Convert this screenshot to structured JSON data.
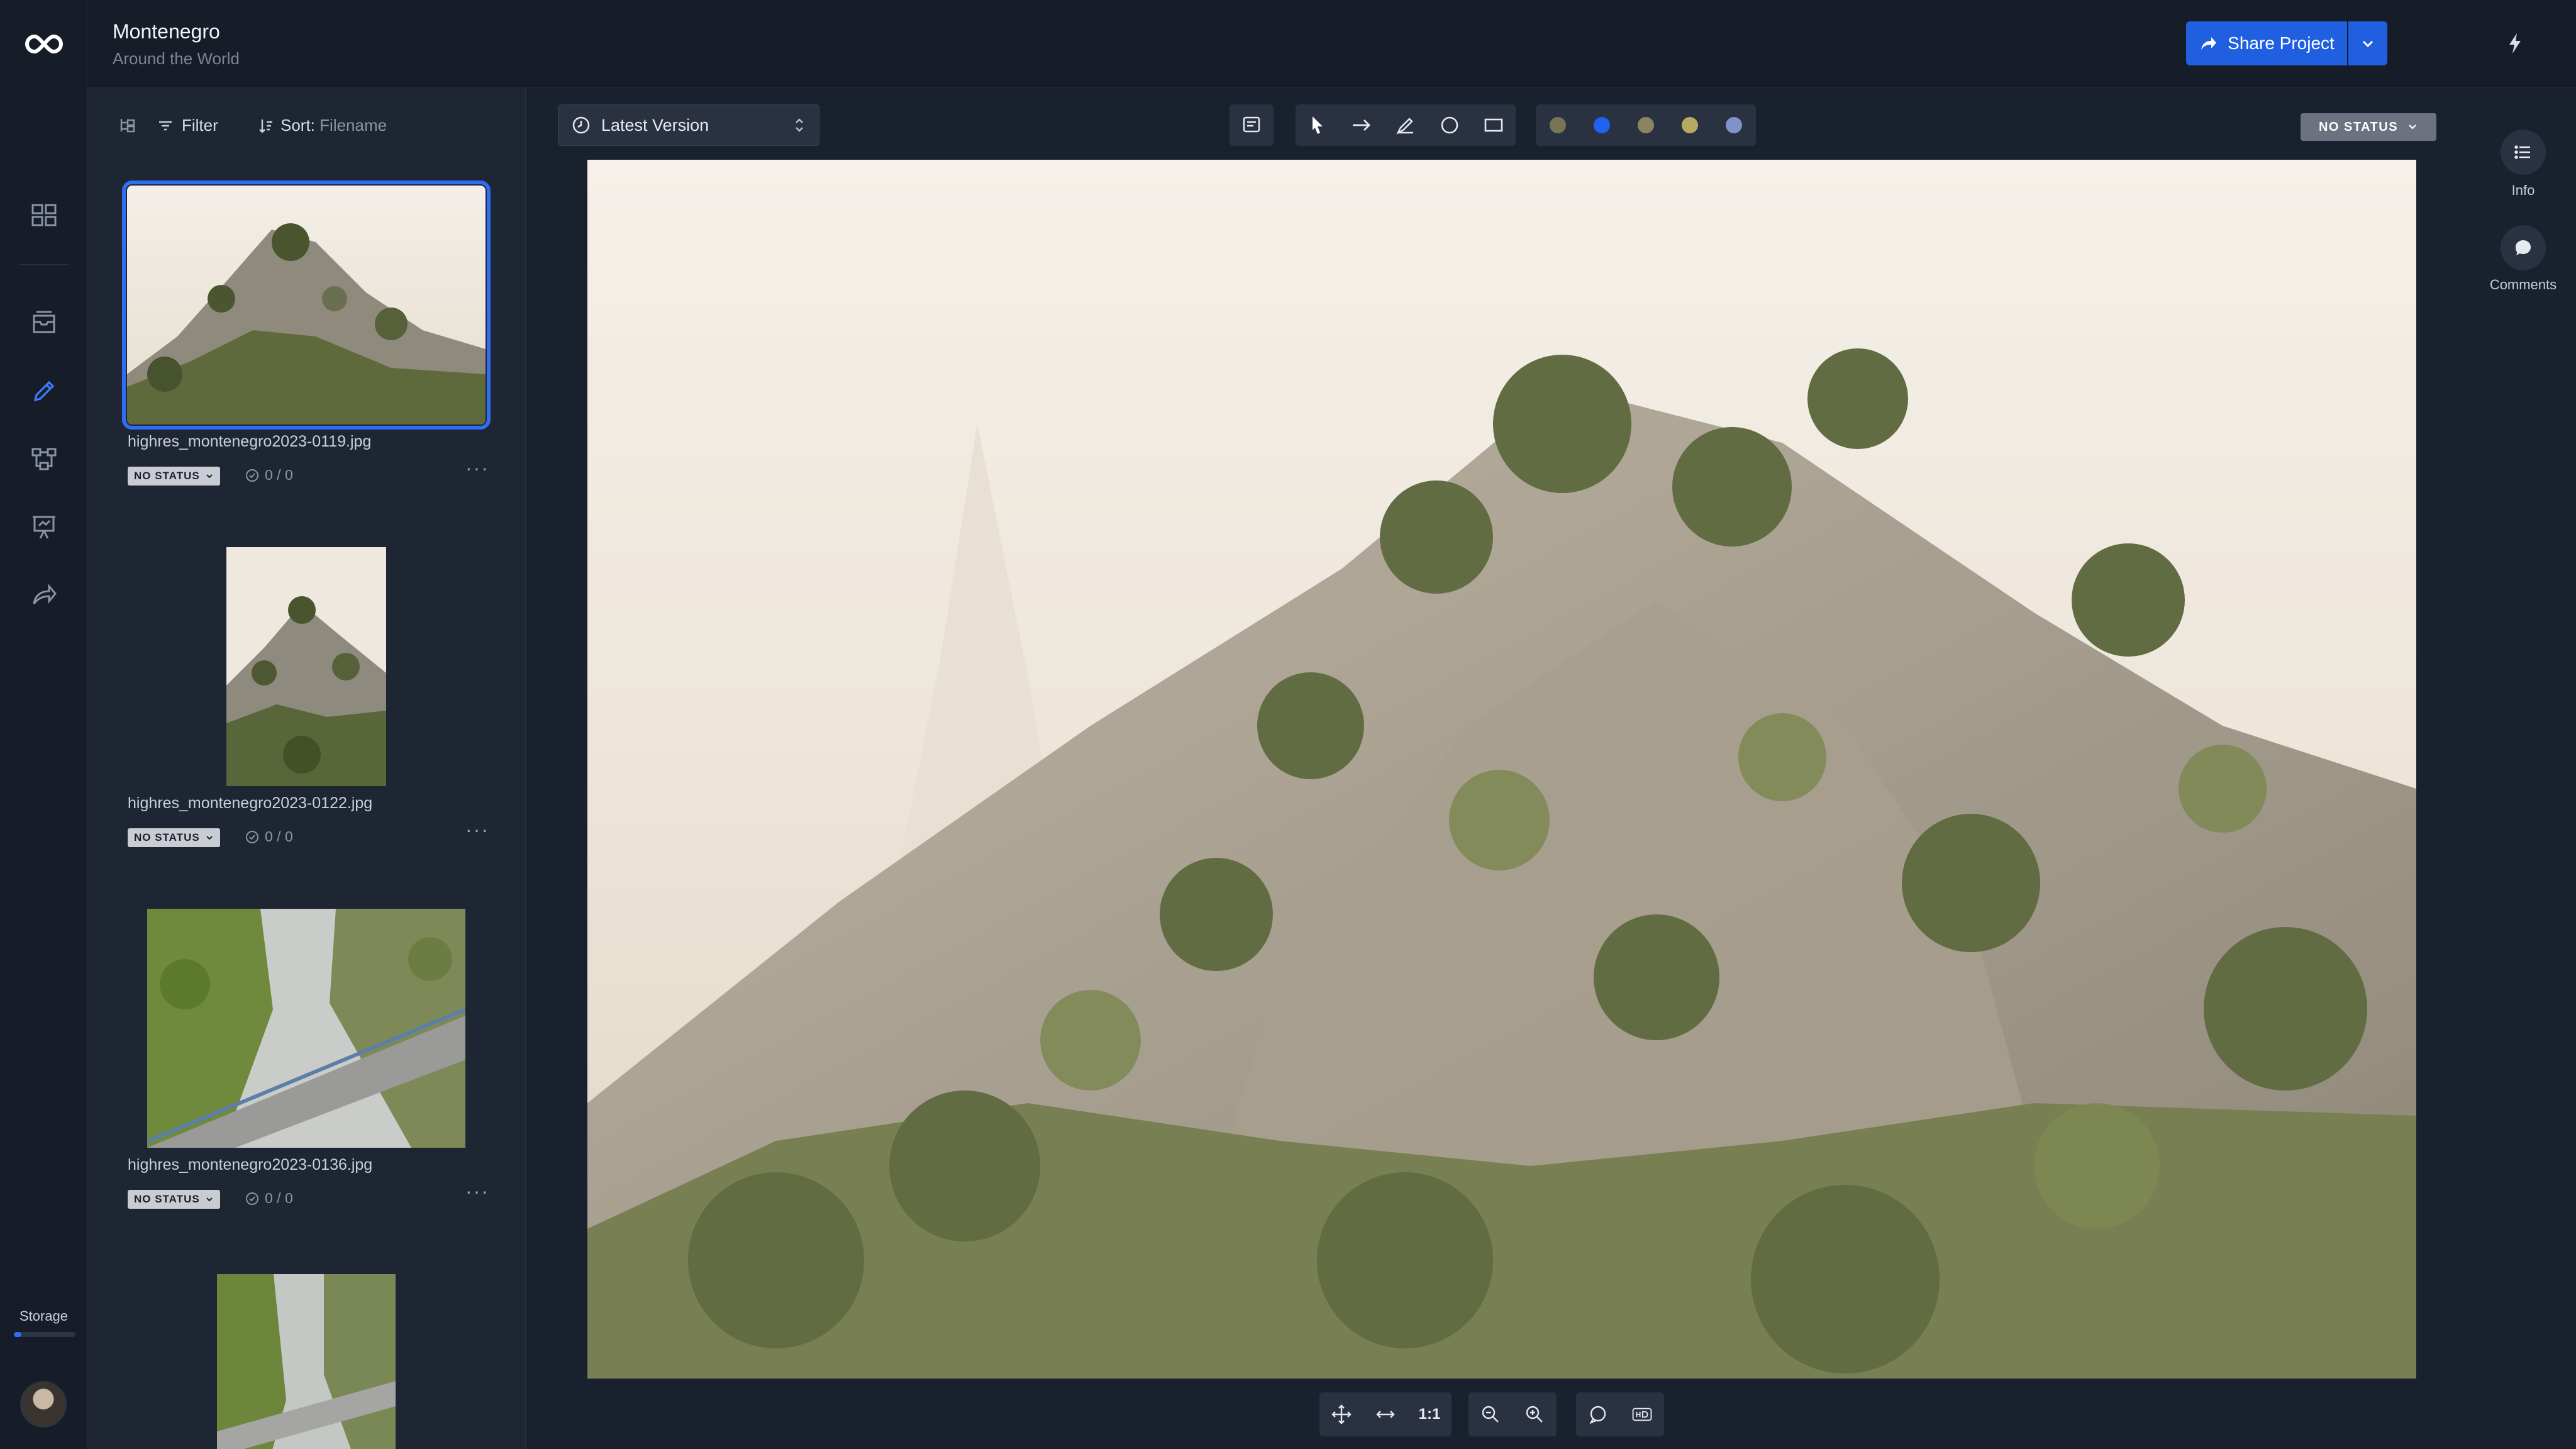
{
  "project": {
    "title": "Montenegro",
    "subtitle": "Around the World"
  },
  "topbar": {
    "share_label": "Share Project"
  },
  "panel": {
    "filter_label": "Filter",
    "sort_label": "Sort:",
    "sort_value": "Filename",
    "files": [
      {
        "name": "highres_montenegro2023-0119.jpg",
        "status": "NO STATUS",
        "count": "0 / 0",
        "selected": true
      },
      {
        "name": "highres_montenegro2023-0122.jpg",
        "status": "NO STATUS",
        "count": "0 / 0",
        "selected": false
      },
      {
        "name": "highres_montenegro2023-0136.jpg",
        "status": "NO STATUS",
        "count": "0 / 0",
        "selected": false
      }
    ]
  },
  "viewer": {
    "version_label": "Latest Version",
    "status_label": "NO STATUS",
    "zoom_one_to_one": "1:1",
    "colors": [
      "#7a7456",
      "#1f62f0",
      "#8a8560",
      "#b8a962",
      "#7f93c8"
    ]
  },
  "side": {
    "info_label": "Info",
    "comments_label": "Comments"
  },
  "rail": {
    "storage_label": "Storage",
    "storage_used_fraction": 0.12
  }
}
